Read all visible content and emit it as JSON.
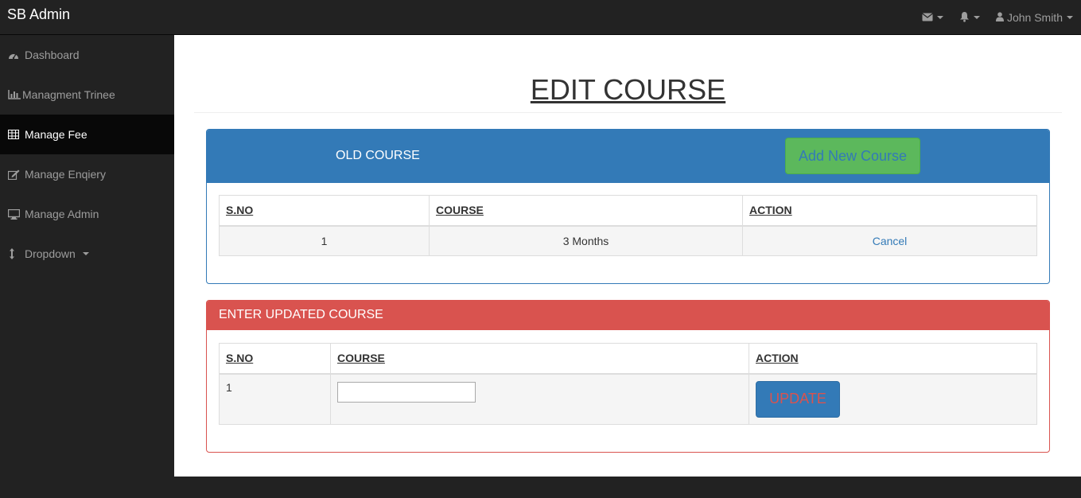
{
  "app": {
    "brand": "SB Admin"
  },
  "topnav": {
    "user_name": "John Smith"
  },
  "sidebar": {
    "items": [
      {
        "label": "Dashboard",
        "icon": "dashboard-icon"
      },
      {
        "label": "Managment Trinee",
        "icon": "bar-chart-icon"
      },
      {
        "label": "Manage Fee",
        "icon": "table-icon",
        "active": true
      },
      {
        "label": "Manage Enqiery",
        "icon": "edit-icon"
      },
      {
        "label": "Manage Admin",
        "icon": "desktop-icon"
      },
      {
        "label": "Dropdown",
        "icon": "arrows-vertical-icon"
      }
    ]
  },
  "main": {
    "title": "EDIT COURSE",
    "old_panel": {
      "heading": "OLD COURSE",
      "add_button": "Add New Course",
      "headers": [
        "S.NO",
        "COURSE",
        "ACTION"
      ],
      "rows": [
        {
          "sno": "1",
          "course": "3 Months",
          "action": "Cancel"
        }
      ]
    },
    "new_panel": {
      "heading": "ENTER UPDATED COURSE",
      "headers": [
        "S.NO",
        "COURSE",
        "ACTION"
      ],
      "rows": [
        {
          "sno": "1",
          "course_value": "",
          "action": "UPDATE"
        }
      ]
    }
  },
  "colors": {
    "navbar_bg": "#222222",
    "primary": "#337ab7",
    "danger": "#d9534f",
    "success": "#5cb85c"
  }
}
